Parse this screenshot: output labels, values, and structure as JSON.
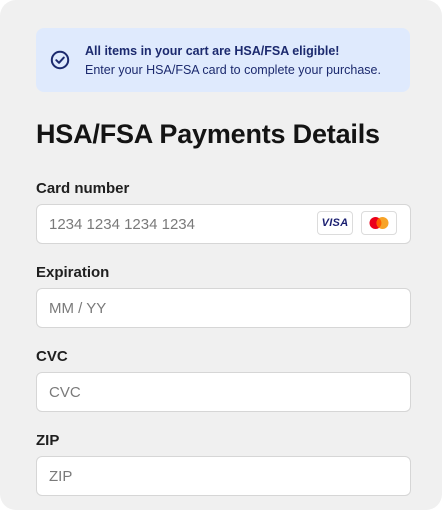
{
  "notice": {
    "title": "All items in your cart are HSA/FSA eligible!",
    "subtitle": "Enter your HSA/FSA card to complete your purchase.",
    "icon": "check-circle-icon",
    "accent_color": "#1c2a6e",
    "background_color": "#dfeafd"
  },
  "heading": "HSA/FSA Payments Details",
  "fields": {
    "card_number": {
      "label": "Card number",
      "placeholder": "1234 1234 1234 1234",
      "value": ""
    },
    "expiration": {
      "label": "Expiration",
      "placeholder": "MM / YY",
      "value": ""
    },
    "cvc": {
      "label": "CVC",
      "placeholder": "CVC",
      "value": ""
    },
    "zip": {
      "label": "ZIP",
      "placeholder": "ZIP",
      "value": ""
    }
  },
  "card_brands": {
    "visa": "VISA",
    "mastercard_icon": "mastercard-icon"
  }
}
